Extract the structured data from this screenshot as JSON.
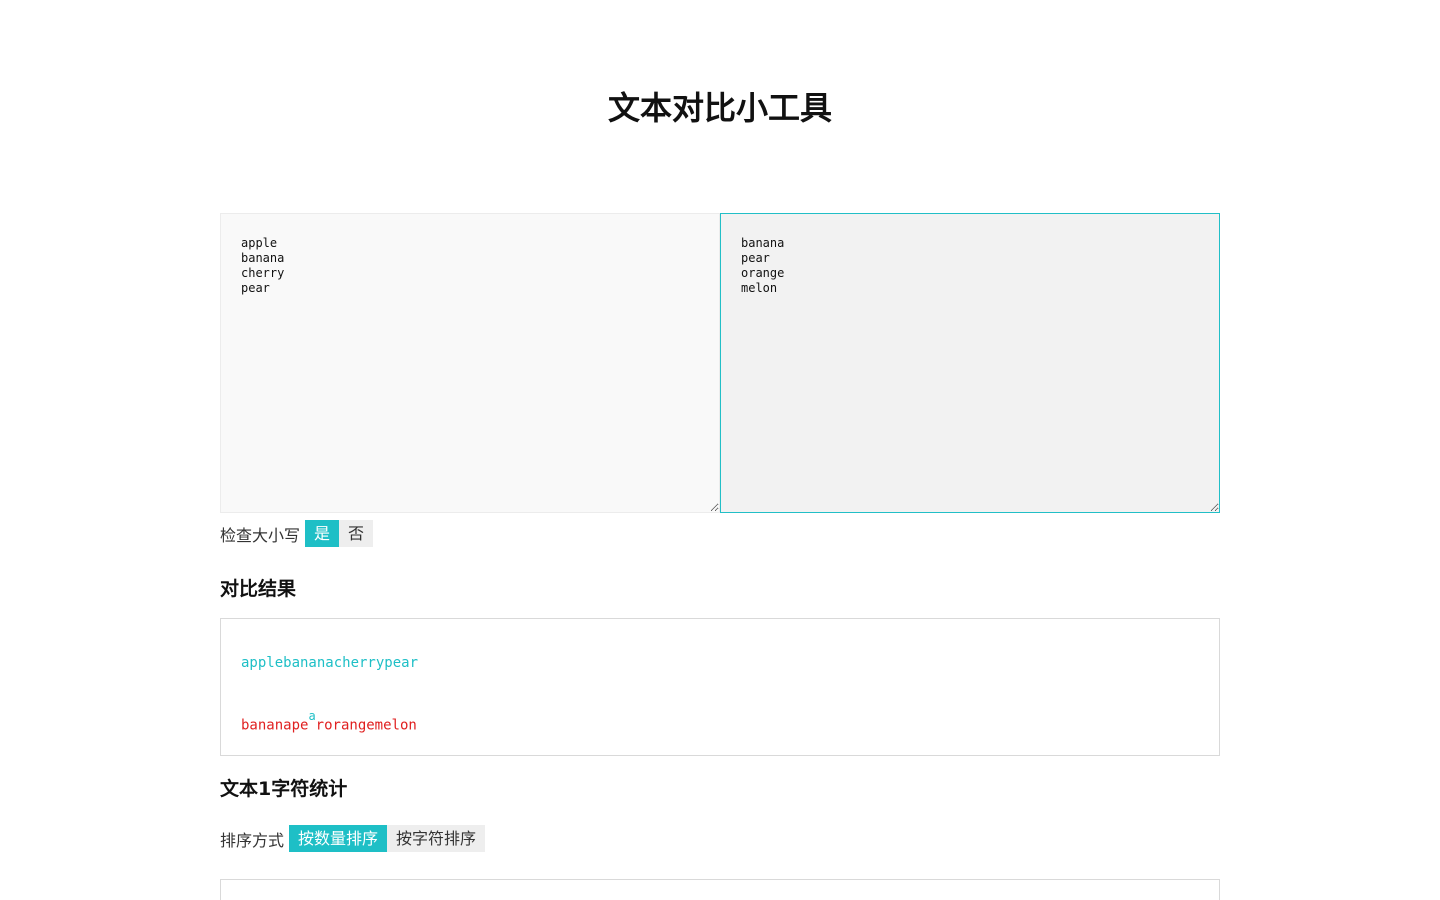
{
  "header": {
    "title": "文本对比小工具"
  },
  "editors": {
    "text1": "apple\nbanana\ncherry\npear",
    "text2": "banana\npear\norange\nmelon"
  },
  "case_check": {
    "label": "检查大小写",
    "yes_label": "是",
    "no_label": "否",
    "selected": "是"
  },
  "result": {
    "heading": "对比结果",
    "line1": "applebananacherrypear",
    "line2_before": "bananape",
    "line2_insert": "a",
    "line2_after": "rorangemelon"
  },
  "stats": {
    "heading": "文本1字符统计",
    "sort_label": "排序方式",
    "sort_by_count": "按数量排序",
    "sort_by_char": "按字符排序",
    "selected": "按数量排序"
  },
  "colors": {
    "accent": "#1ebfc6",
    "removed": "#e02020",
    "inactive_bg": "#eeeeee"
  }
}
